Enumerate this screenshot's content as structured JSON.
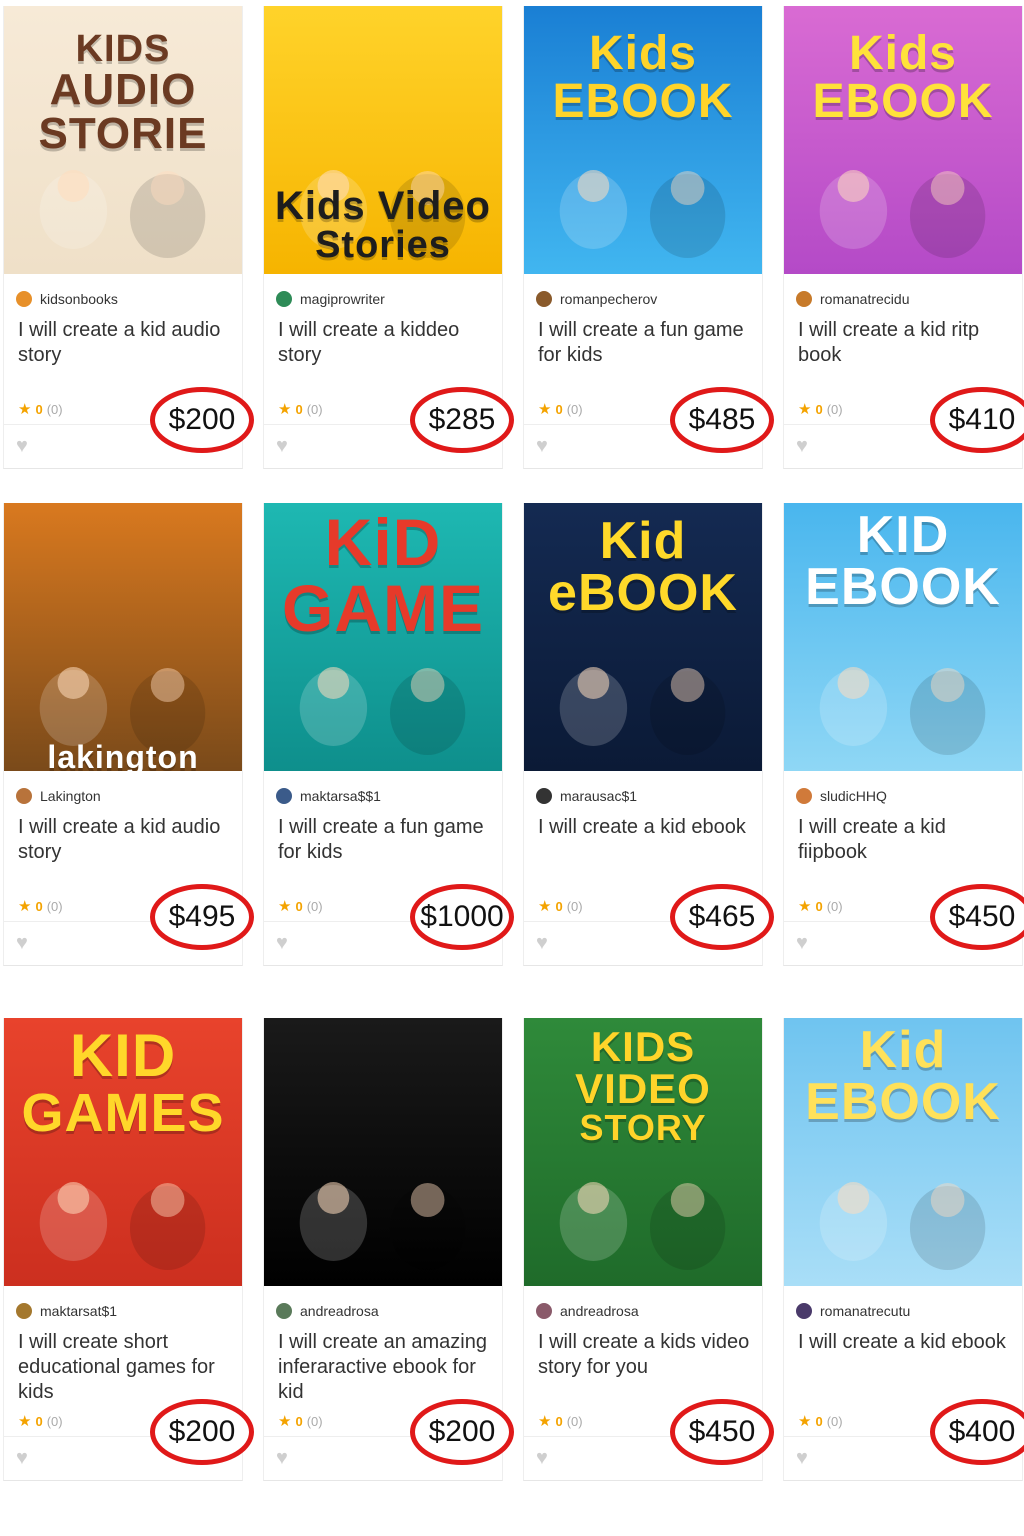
{
  "gigs": [
    {
      "cover_text": "KIDS\nAUDIO\nSTORIE",
      "seller": "kidsonbooks",
      "title": "I will create a kid audio story",
      "rating": "0",
      "reviews": "(0)",
      "price": "$200",
      "bg": [
        "#f7ead7",
        "#efe0c8"
      ],
      "text_color": "#6b3a22",
      "avatar": "#e7902a"
    },
    {
      "cover_text": "Kids Video\nStories",
      "seller": "magiprowriter",
      "title": "I will create a kiddeo story",
      "rating": "0",
      "reviews": "(0)",
      "price": "$285",
      "bg": [
        "#ffd32a",
        "#f6b400"
      ],
      "text_color": "#1d1d1d",
      "avatar": "#2e8b57"
    },
    {
      "cover_text": "Kids\nEBOOK",
      "seller": "romanpecherov",
      "title": "I will create a fun game for kids",
      "rating": "0",
      "reviews": "(0)",
      "price": "$485",
      "bg": [
        "#1a7fd4",
        "#41b6f0"
      ],
      "text_color": "#ffd42a",
      "avatar": "#8a5a2b"
    },
    {
      "cover_text": "Kids\nEBOOK",
      "seller": "romanatrecidu",
      "title": "I will create a kid ritp book",
      "rating": "0",
      "reviews": "(0)",
      "price": "$410",
      "bg": [
        "#d96bd3",
        "#b44ac7"
      ],
      "text_color": "#ffe23a",
      "avatar": "#c77a2a"
    },
    {
      "cover_text": "lakington",
      "seller": "Lakington",
      "title": "I will create a kid audio story",
      "rating": "0",
      "reviews": "(0)",
      "price": "$495",
      "bg": [
        "#d9791f",
        "#7a4a1a"
      ],
      "text_color": "#ffffff",
      "avatar": "#b8733b"
    },
    {
      "cover_text": "KiD\nGAME",
      "seller": "maktarsa$$1",
      "title": "I will create a fun game for kids",
      "rating": "0",
      "reviews": "(0)",
      "price": "$1000",
      "bg": [
        "#1eb8b2",
        "#0e8f8c"
      ],
      "text_color": "#e63a2a",
      "avatar": "#3b5b8a"
    },
    {
      "cover_text": "Kid\neBOOK",
      "seller": "marausac$1",
      "title": "I will create a kid ebook",
      "rating": "0",
      "reviews": "(0)",
      "price": "$465",
      "bg": [
        "#142a52",
        "#0b1a36"
      ],
      "text_color": "#ffd92a",
      "avatar": "#333333"
    },
    {
      "cover_text": "KID\nEBOOK",
      "seller": "sludicHHQ",
      "title": "I will create a  kid fiipbook",
      "rating": "0",
      "reviews": "(0)",
      "price": "$450",
      "bg": [
        "#49b6ee",
        "#8fd7f5"
      ],
      "text_color": "#ffffff",
      "avatar": "#d07a3a"
    },
    {
      "cover_text": "KID\nGAMES",
      "seller": "maktarsat$1",
      "title": "I will create short educational  games for kids",
      "rating": "0",
      "reviews": "(0)",
      "price": "$200",
      "bg": [
        "#e8432c",
        "#cc2f1f"
      ],
      "text_color": "#ffd72a",
      "avatar": "#a4782e"
    },
    {
      "cover_text": "",
      "seller": "andreadrosa",
      "title": "I will create an amazing inferaractive ebook for kid",
      "rating": "0",
      "reviews": "(0)",
      "price": "$200",
      "bg": [
        "#1a1a1a",
        "#000000"
      ],
      "text_color": "#ffffff",
      "avatar": "#5a7a5a"
    },
    {
      "cover_text": "KIDS\nVIDEO\nSTORY",
      "seller": "andreadrosa",
      "title": "I will create a kids video story for you",
      "rating": "0",
      "reviews": "(0)",
      "price": "$450",
      "bg": [
        "#2f8a3a",
        "#1f6b2a"
      ],
      "text_color": "#ffd42a",
      "avatar": "#8a5a6a"
    },
    {
      "cover_text": "Kid\nEBOOK",
      "seller": "romanatrecutu",
      "title": "I will create a kid ebook",
      "rating": "0",
      "reviews": "(0)",
      "price": "$400",
      "bg": [
        "#6fc4f0",
        "#a9def7"
      ],
      "text_color": "#ffe15a",
      "avatar": "#4a3a6a"
    }
  ]
}
